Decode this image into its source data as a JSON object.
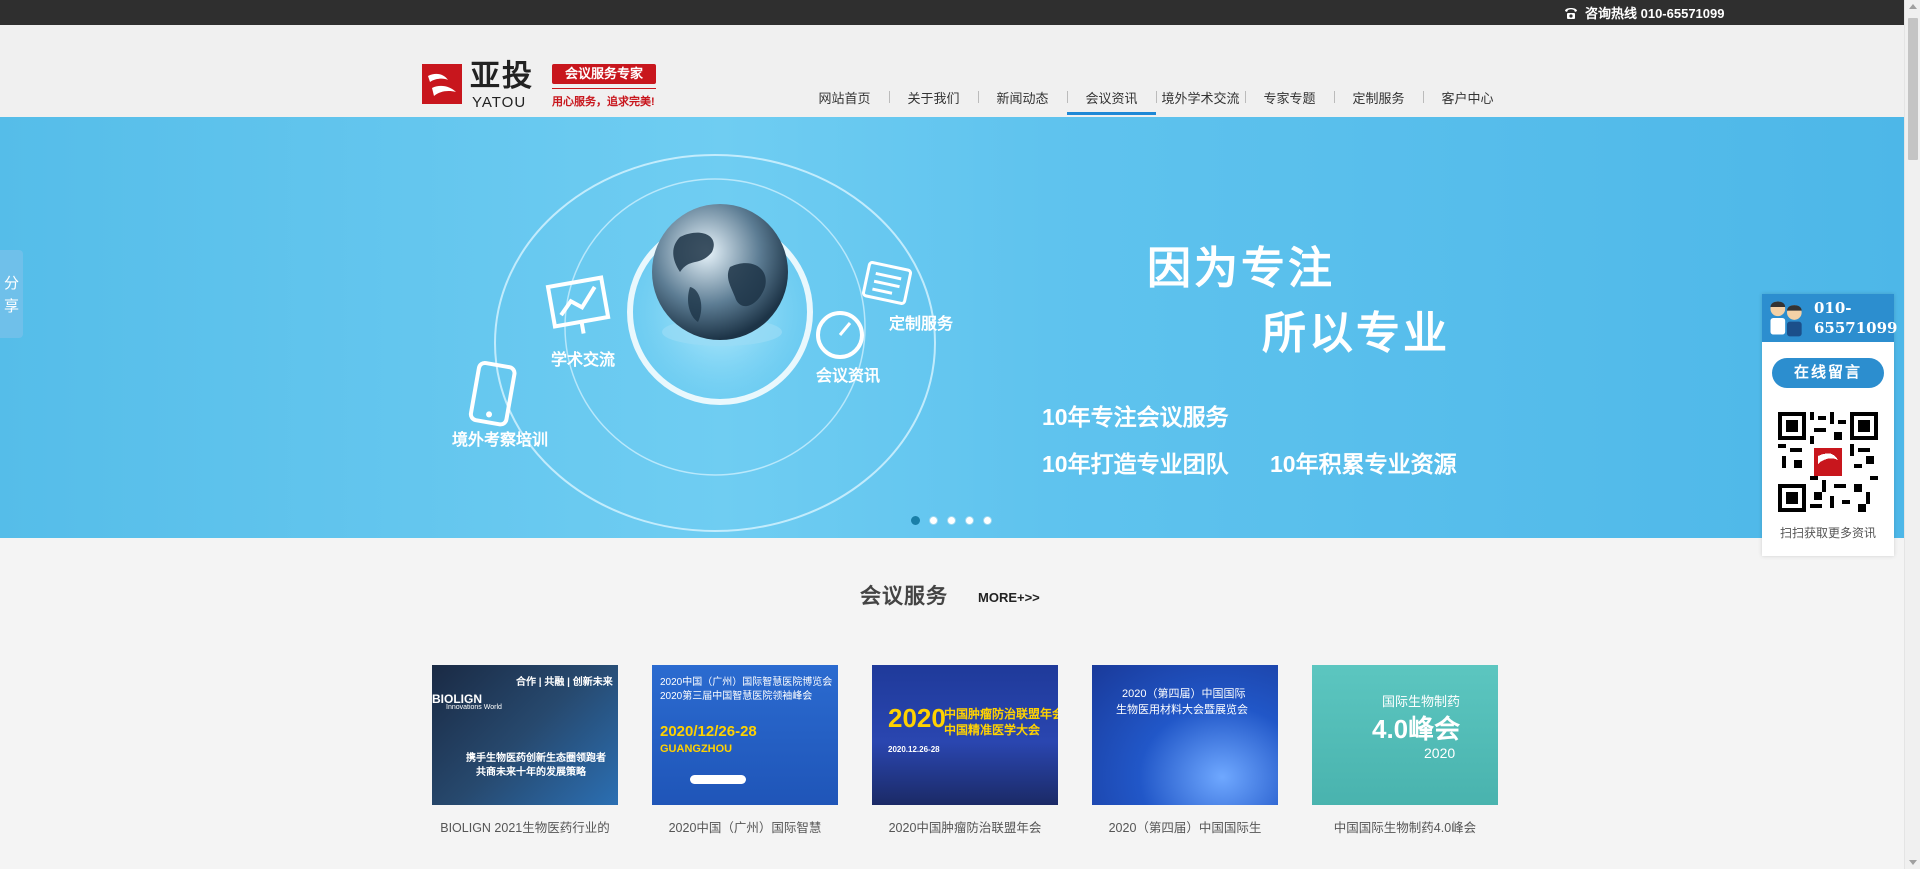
{
  "topbar": {
    "hotline_label": "咨询热线 010-65571099",
    "phone_icon": "phone-icon"
  },
  "logo": {
    "cn": "亚投",
    "en": "YATOU",
    "badge": "会议服务专家",
    "slogan": "用心服务，追求完美!"
  },
  "nav": {
    "items": [
      {
        "label": "网站首页",
        "active": false
      },
      {
        "label": "关于我们",
        "active": false
      },
      {
        "label": "新闻动态",
        "active": false
      },
      {
        "label": "会议资讯",
        "active": true
      },
      {
        "label": "境外学术交流",
        "active": false
      },
      {
        "label": "专家专题",
        "active": false
      },
      {
        "label": "定制服务",
        "active": false
      },
      {
        "label": "客户中心",
        "active": false
      }
    ]
  },
  "banner": {
    "slogan_line1": "因为专注",
    "slogan_line2": "所以专业",
    "stat1": "10年专注会议服务",
    "stat2": "10年打造专业团队",
    "stat3": "10年积累专业资源",
    "orbit_labels": [
      "学术交流",
      "定制服务",
      "会议资讯",
      "境外考察培训"
    ],
    "slide_count": 5,
    "active_slide": 1
  },
  "share": {
    "chars": [
      "分",
      "享"
    ]
  },
  "float_panel": {
    "phone_line1": "010-",
    "phone_line2": "65571099",
    "message_button": "在线留言",
    "qr_caption": "扫扫获取更多资讯"
  },
  "section": {
    "title": "会议服务",
    "more": "MORE+>>"
  },
  "cards": [
    {
      "caption": "BIOLIGN 2021生物医药行业的",
      "img_lines": [
        "BIOLIGN",
        "Innovations World",
        "合作 | 共融 | 创新未来",
        "携手生物医药创新生态圈领跑者",
        "共商未来十年的发展策略"
      ]
    },
    {
      "caption": "2020中国（广州）国际智慧",
      "img_lines": [
        "2020中国（广州）国际智慧医院博览会",
        "2020第三届中国智慧医院领袖峰会",
        "2020/12/26-28",
        "GUANGZHOU"
      ]
    },
    {
      "caption": "2020中国肿瘤防治联盟年会",
      "img_lines": [
        "2020",
        "中国肿瘤防治联盟年会",
        "中国精准医学大会",
        "2020.12.26-28"
      ]
    },
    {
      "caption": "2020（第四届）中国国际生",
      "img_lines": [
        "2020（第四届）中国国际",
        "生物医用材料大会暨展览会"
      ]
    },
    {
      "caption": "中国国际生物制药4.0峰会",
      "img_lines": [
        "国际生物制药",
        "4.0峰会",
        "2020"
      ]
    }
  ],
  "colors": {
    "topbar": "#2f2f2f",
    "accent_blue": "#1e88d6",
    "brand_red": "#c8161d",
    "banner_blue": "#5fc3ee"
  }
}
